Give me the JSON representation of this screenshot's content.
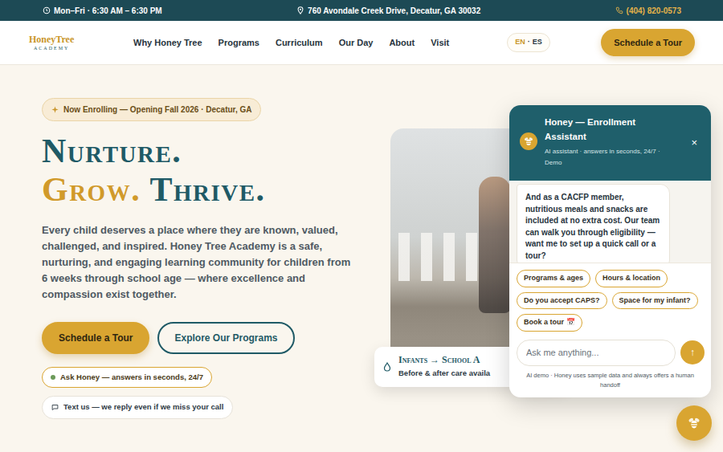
{
  "topbar": {
    "hours": "Mon–Fri · 6:30 AM – 6:30 PM",
    "address": "760 Avondale Creek Drive, Decatur, GA 30032",
    "phone": "(404) 820-0573"
  },
  "nav": {
    "logo": {
      "name": "HoneyTree",
      "sub": "ACADEMY"
    },
    "links": [
      "Why Honey Tree",
      "Programs",
      "Curriculum",
      "Our Day",
      "About",
      "Visit"
    ],
    "languages": [
      {
        "label": "EN",
        "selected": true
      },
      {
        "label": "ES",
        "selected": false
      }
    ],
    "language_separator": "·",
    "cta": "Schedule a Tour"
  },
  "hero": {
    "badge": "Now Enrolling — Opening Fall 2026 · Decatur, GA",
    "heading": [
      [
        {
          "text": "Nurture.",
          "color": "#1f5a66"
        }
      ],
      [
        {
          "text": "Grow.",
          "color": "#d19a2a"
        },
        {
          "text": "Thrive.",
          "color": "#1f5a66"
        }
      ]
    ],
    "intro": "Every child deserves a place where they are known, valued, challenged, and inspired. Honey Tree Academy is a safe, nurturing, and engaging learning community for children from 6 weeks through school age — where excellence and compassion exist together.",
    "buttons": [
      {
        "label": "Schedule a Tour",
        "kind": "primary"
      },
      {
        "label": "Explore Our Programs",
        "kind": "outline"
      }
    ],
    "pills": [
      {
        "label": "Ask Honey — answers in seconds, 24/7",
        "kind": "status"
      },
      {
        "label": "Text us — we reply even if we miss your call",
        "kind": "chat"
      }
    ]
  },
  "photo_caption": {
    "title": "Infants → School A",
    "subtitle": "Before & after care availa"
  },
  "chat": {
    "title": "Honey — Enrollment Assistant",
    "subtitle": "AI assistant · answers in seconds, 24/7 · Demo",
    "close": "×",
    "messages": [
      {
        "from": "assistant",
        "text": "And as a CACFP member, nutritious meals and snacks are included at no extra cost. Our team can walk you through eligibility — want me to set up a quick call or a tour?"
      }
    ],
    "suggestions": [
      "Programs & ages",
      "Hours & location",
      "Do you accept CAPS?",
      "Space for my infant?",
      "Book a tour 📅"
    ],
    "input_placeholder": "Ask me anything...",
    "send": "↑",
    "note": "AI demo · Honey uses sample data and always offers a human handoff"
  }
}
